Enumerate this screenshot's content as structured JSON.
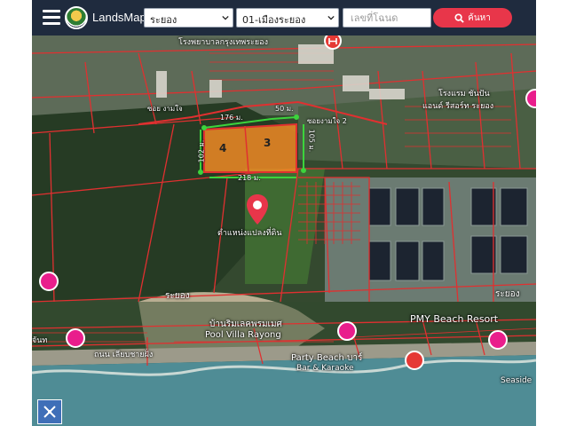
{
  "header": {
    "brand": "LandsMaps",
    "province_select": "ระยอง",
    "district_select": "01-เมืองระยอง",
    "deed_input_placeholder": "เลขที่โฉนด",
    "search_button": "ค้นหา"
  },
  "map": {
    "measurements": {
      "top_left": "176 ม.",
      "top_right": "50 ม.",
      "left_side": "102 ม.",
      "right_side": "105 ม.",
      "bottom": "218 ม."
    },
    "plots": [
      "4",
      "3"
    ],
    "pin_label": "ตำแหน่งแปลงที่ดิน",
    "places": {
      "hospital_label": "โรงพยาบาลกรุงเทพระยอง",
      "road_top": "ซอย งามใจ",
      "road_top_right": "ซอยงามใจ 2",
      "hotel_right": "โรงแรม ชันปัน",
      "resort_right": "แอนด์ รีสอร์ท ระยอง",
      "area_label_1": "ระยอง",
      "area_label_2": "ระยอง",
      "resort_left_th": "บ้านริมเลคพรมเมศ",
      "resort_left_en": "Pool Villa Rayong",
      "pmy": "PMY Beach Resort",
      "party_beach": "Party Beach บาร์",
      "bar_karaoke": "Bar & Karaoke",
      "beach_road": "ถนน เลียบชายฝั่ง",
      "left_edge": "จันท",
      "right_edge": "Seaside"
    },
    "colors": {
      "parcel_line": "#e03030",
      "selected_plot": "#f08a24",
      "measure_line": "#3cd43c",
      "pin": "#e8364a",
      "header_bg": "#1f2b3e",
      "search_btn": "#e8364a"
    }
  }
}
